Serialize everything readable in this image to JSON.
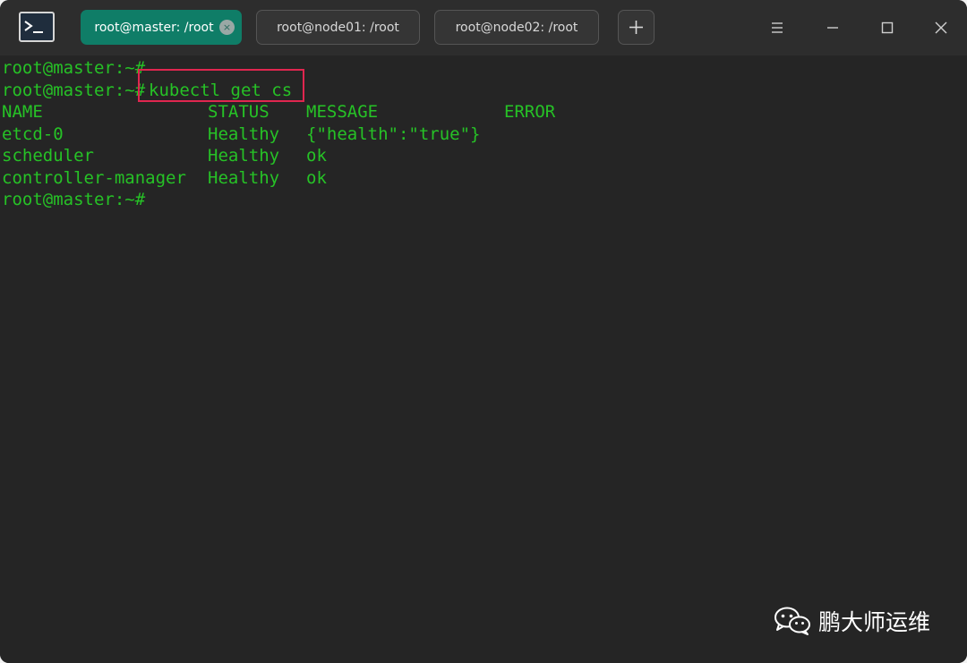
{
  "tabs": [
    {
      "label": "root@master: /root",
      "active": true,
      "close_label": "×"
    },
    {
      "label": "root@node01: /root",
      "active": false
    },
    {
      "label": "root@node02: /root",
      "active": false
    }
  ],
  "terminal": {
    "lines": [
      {
        "text": "root@master:~#"
      },
      {
        "prompt": "root@master:~#",
        "command": "kubectl get cs"
      },
      {
        "cols": [
          "NAME",
          "STATUS",
          "MESSAGE",
          "ERROR"
        ]
      },
      {
        "cols": [
          "etcd-0",
          "Healthy",
          "{\"health\":\"true\"}",
          ""
        ]
      },
      {
        "cols": [
          "scheduler",
          "Healthy",
          "ok",
          ""
        ]
      },
      {
        "cols": [
          "controller-manager",
          "Healthy",
          "ok",
          ""
        ]
      },
      {
        "text": "root@master:~#"
      }
    ],
    "text_color": "#26c226",
    "background": "#252525",
    "highlight_color": "#e0264f"
  },
  "watermark": {
    "text": "鹏大师运维",
    "icon": "wechat-icon"
  },
  "icons": {
    "app": "terminal-app-icon",
    "new_tab": "plus-icon",
    "menu": "hamburger-menu-icon",
    "minimize": "minimize-icon",
    "maximize": "maximize-icon",
    "close": "close-icon"
  },
  "colors": {
    "accent": "#0f7d67",
    "titlebar": "#2d2d2d"
  }
}
